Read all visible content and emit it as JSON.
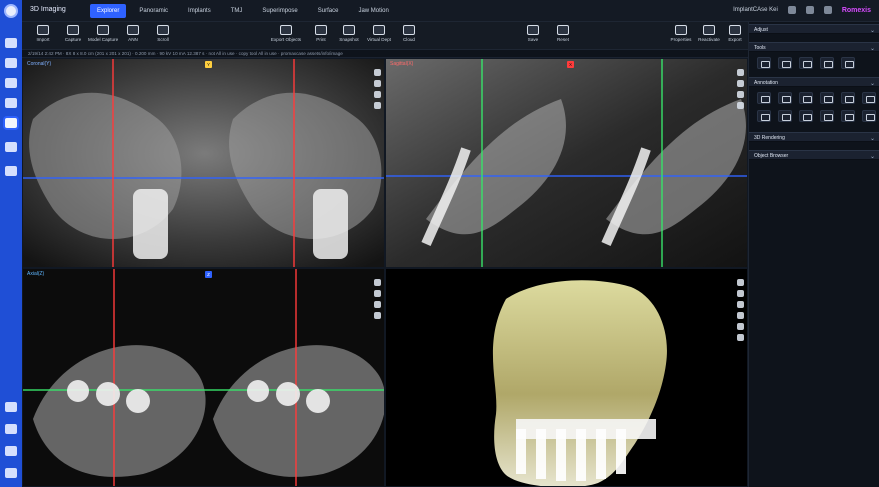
{
  "app": {
    "title": "3D Imaging",
    "case_name": "ImplantCAse Kei",
    "brand": "Romexis"
  },
  "top_tabs": [
    {
      "label": "Explorer",
      "active": true
    },
    {
      "label": "Panoramic",
      "active": false
    },
    {
      "label": "Implants",
      "active": false
    },
    {
      "label": "TMJ",
      "active": false
    },
    {
      "label": "Superimpose",
      "active": false
    },
    {
      "label": "Surface",
      "active": false
    },
    {
      "label": "Jaw Motion",
      "active": false
    }
  ],
  "toolbar": {
    "left_tools": [
      {
        "label": "Import",
        "icon": "import-icon"
      },
      {
        "label": "Capture",
        "icon": "capture-icon"
      },
      {
        "label": "Model Capture",
        "icon": "model-capture-icon"
      },
      {
        "label": "ANN",
        "icon": "ann-icon"
      },
      {
        "label": "Scroll",
        "icon": "scroll-icon"
      }
    ],
    "middle_tools": [
      {
        "label": "Export Objects",
        "icon": "export-objects-icon"
      },
      {
        "label": "Print",
        "icon": "print-icon"
      },
      {
        "label": "Snapshot",
        "icon": "snapshot-icon"
      },
      {
        "label": "Virtual Dept",
        "icon": "virtual-dept-icon"
      },
      {
        "label": "Cloud",
        "icon": "cloud-icon"
      }
    ],
    "save_tools": [
      {
        "label": "Save",
        "icon": "save-icon"
      },
      {
        "label": "Reset",
        "icon": "reset-icon"
      }
    ],
    "right_tools": [
      {
        "label": "Properties",
        "icon": "properties-icon"
      },
      {
        "label": "Reactivate",
        "icon": "reactivate-icon"
      },
      {
        "label": "Export",
        "icon": "export-icon"
      }
    ]
  },
  "infobar": {
    "text": "2/19/14 2:42 PM · 8X 8 x 8.0 cm (201 x 201 x 201) · 0.200 mm · 90 kV 10 mA 12.387 s · not All in use · copy tool All in use · promaxcase assets/info/image"
  },
  "viewports": {
    "coronal": {
      "label": "Coronal(Y)"
    },
    "sagittal": {
      "label": "Sagittal(X)"
    },
    "axial": {
      "label": "Axial(Z)"
    },
    "volume": {
      "label": ""
    }
  },
  "right_panel": {
    "sections": [
      {
        "title": "Adjust"
      },
      {
        "title": "Tools"
      },
      {
        "title": "Annotation"
      },
      {
        "title": "3D Rendering"
      },
      {
        "title": "Object Browser"
      }
    ]
  },
  "theme": {
    "accent": "#2f62ff",
    "brand_color": "#d84cff",
    "left_rail": "#1f4fd6"
  }
}
